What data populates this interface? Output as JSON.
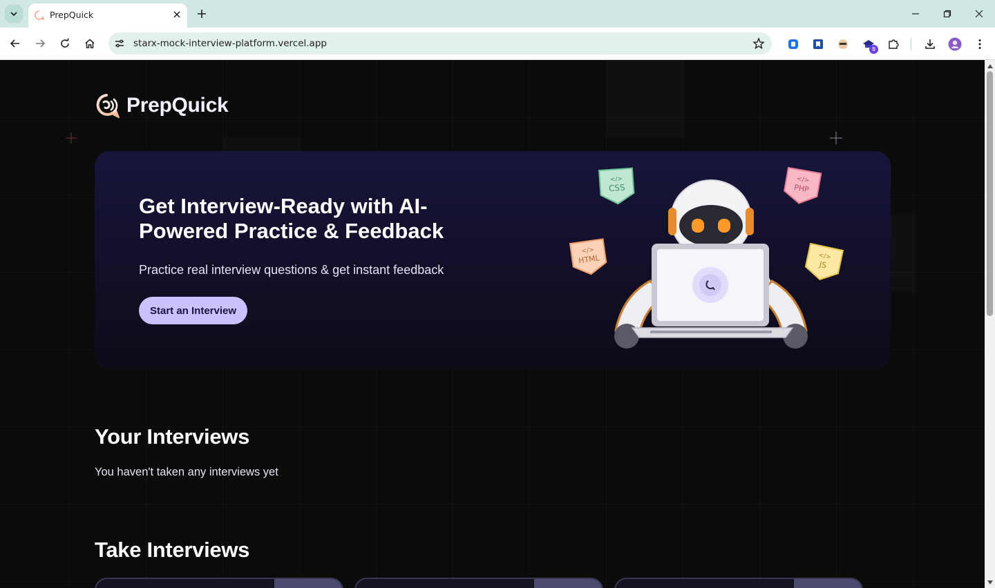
{
  "browser": {
    "tab_title": "PrepQuick",
    "url": "starx-mock-interview-platform.vercel.app",
    "extension_badge": "8"
  },
  "page": {
    "logo_text": "PrepQuick",
    "hero": {
      "title": "Get Interview-Ready with AI-Powered Practice & Feedback",
      "subtitle": "Practice real interview questions & get instant feedback",
      "cta_label": "Start an Interview",
      "badges": [
        "CSS",
        "PHP",
        "HTML",
        "JS"
      ]
    },
    "your_interviews": {
      "heading": "Your Interviews",
      "empty_message": "You haven't taken any interviews yet"
    },
    "take_interviews": {
      "heading": "Take Interviews"
    }
  },
  "colors": {
    "background": "#0b0b0c",
    "hero_top": "#17153a",
    "accent": "#cac2ff",
    "logo": "#f2f0ff",
    "tabbar": "#cfe8e3"
  }
}
